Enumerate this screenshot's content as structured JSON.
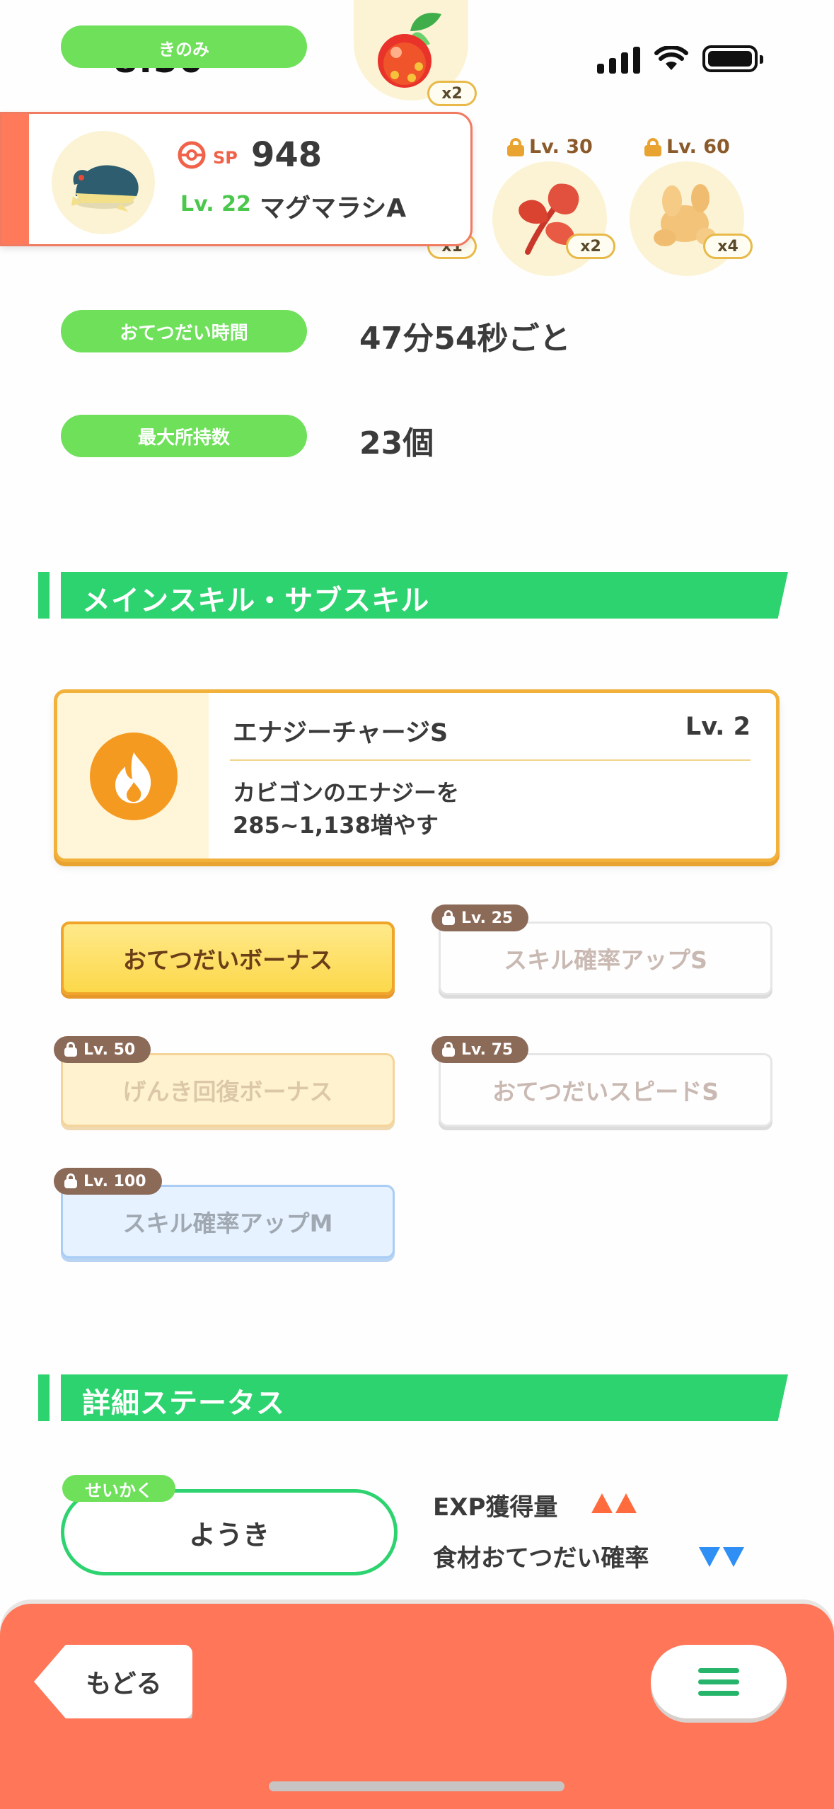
{
  "status_bar": {
    "time": "8:50"
  },
  "berry_row": {
    "label": "きのみ",
    "quantity": "x2"
  },
  "ingredients": [
    {
      "quantity": "x1"
    },
    {
      "lock_level": "Lv. 30",
      "quantity": "x2"
    },
    {
      "lock_level": "Lv. 60",
      "quantity": "x4"
    }
  ],
  "pokemon": {
    "sp_label": "SP",
    "sp_value": "948",
    "level": "Lv. 22",
    "name": "マグマラシA"
  },
  "stats": {
    "help_time_label": "おてつだい時間",
    "help_time_value": "47分54秒ごと",
    "max_carry_label": "最大所持数",
    "max_carry_value": "23個"
  },
  "skills_section": {
    "title": "メインスキル・サブスキル",
    "main_skill": {
      "name": "エナジーチャージS",
      "level": "Lv. 2",
      "description_line1": "カビゴンのエナジーを",
      "description_line2": "285~1,138増やす"
    },
    "sub_skills": [
      {
        "name": "おてつだいボーナス",
        "lock_level": ""
      },
      {
        "name": "スキル確率アップS",
        "lock_level": "Lv. 25"
      },
      {
        "name": "げんき回復ボーナス",
        "lock_level": "Lv. 50"
      },
      {
        "name": "おてつだいスピードS",
        "lock_level": "Lv. 75"
      },
      {
        "name": "スキル確率アップM",
        "lock_level": "Lv. 100"
      }
    ]
  },
  "details_section": {
    "title": "詳細ステータス",
    "nature_tag": "せいかく",
    "nature_value": "ようき",
    "effects": [
      {
        "label": "EXP獲得量",
        "direction": "up",
        "color": "#ff6b3d"
      },
      {
        "label": "食材おてつだい確率",
        "direction": "down",
        "color": "#2f8ff5"
      }
    ]
  },
  "bottom_bar": {
    "back_label": "もどる",
    "menu_icon": "hamburger-menu-icon",
    "color": "#ff7658"
  }
}
